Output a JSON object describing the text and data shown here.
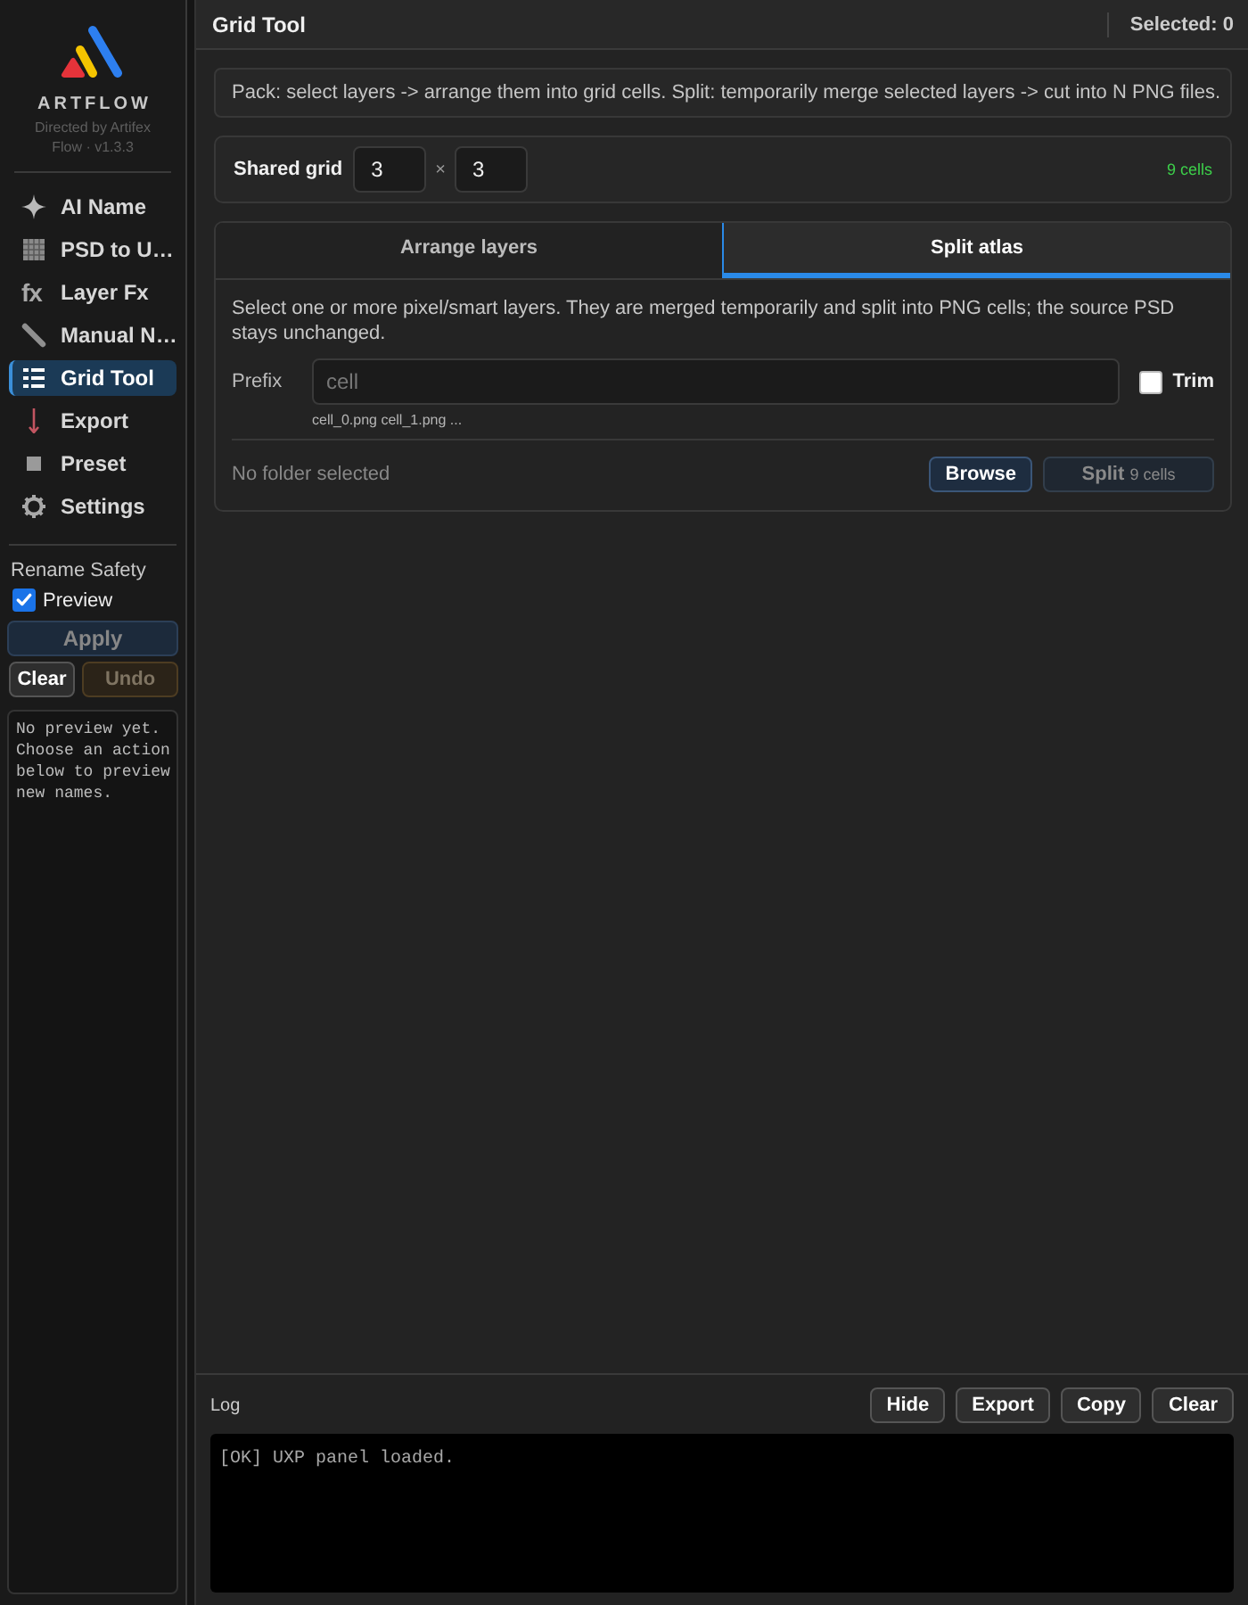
{
  "sidebar": {
    "brand": {
      "name": "ARTFLOW",
      "tagline": "Directed by Artifex Flow · v1.3.3"
    },
    "nav": [
      {
        "label": "AI Name",
        "selected": false
      },
      {
        "label": "PSD to U…",
        "selected": false
      },
      {
        "label": "Layer Fx",
        "icon_text": "fx",
        "selected": false
      },
      {
        "label": "Manual N…",
        "selected": false
      },
      {
        "label": "Grid Tool",
        "selected": true
      },
      {
        "label": "Export",
        "selected": false
      },
      {
        "label": "Preset",
        "selected": false
      },
      {
        "label": "Settings",
        "selected": false
      }
    ],
    "rename_safety": {
      "title": "Rename Safety",
      "preview": {
        "label": "Preview",
        "checked": true
      },
      "apply": {
        "label": "Apply",
        "disabled": true
      },
      "clear": {
        "label": "Clear",
        "disabled": false
      },
      "undo": {
        "label": "Undo",
        "disabled": true
      },
      "preview_text": "No preview yet. Choose an action below to preview new names."
    }
  },
  "header": {
    "title": "Grid Tool",
    "selected_count": "Selected: 0"
  },
  "info": "Pack: select layers -> arrange them into grid cells. Split: temporarily merge selected layers -> cut into N PNG files.",
  "shared_grid": {
    "label": "Shared grid",
    "columns": "3",
    "separator": "×",
    "rows": "3",
    "cells": "9 cells"
  },
  "tabs": [
    {
      "label": "Arrange layers",
      "selected": false
    },
    {
      "label": "Split atlas",
      "selected": true
    }
  ],
  "split_atlas": {
    "description": "Select one or more pixel/smart layers. They are merged temporarily and split into PNG cells; the source PSD stays unchanged.",
    "prefix": {
      "label": "Prefix",
      "placeholder": "cell"
    },
    "trim": {
      "label": "Trim",
      "checked": false
    },
    "hint": "cell_0.png cell_1.png ...",
    "folder": "No folder selected",
    "browse": "Browse",
    "split": {
      "label": "Split",
      "count": "9 cells",
      "disabled": true
    }
  },
  "log": {
    "title": "Log",
    "buttons": [
      "Hide",
      "Export",
      "Copy",
      "Clear"
    ],
    "lines": [
      "[OK] UXP panel loaded."
    ]
  }
}
